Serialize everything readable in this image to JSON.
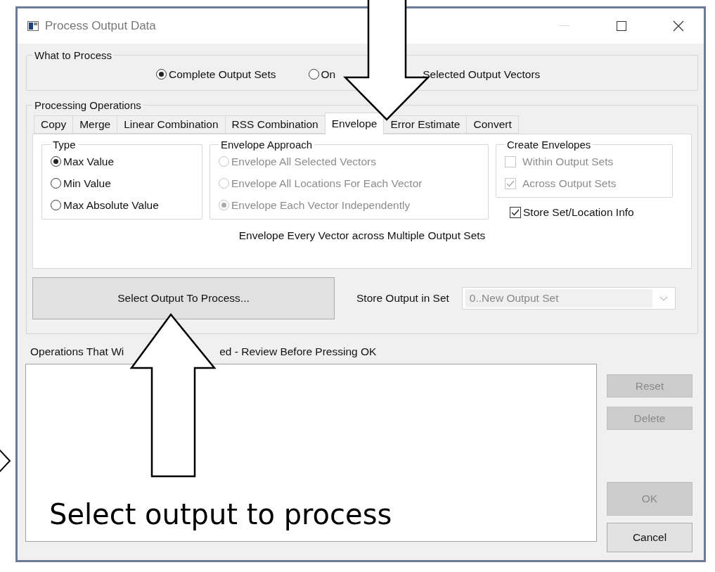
{
  "window": {
    "title": "Process Output Data",
    "minimize_disabled": true
  },
  "what_to_process": {
    "title": "What to Process",
    "options": [
      {
        "label_parts": [
          "Complete Output Sets"
        ],
        "selected": true
      },
      {
        "label_parts": [
          "On",
          "Selected Output Vectors"
        ],
        "selected": false
      }
    ]
  },
  "processing_operations": {
    "title": "Processing Operations",
    "tabs": [
      {
        "label": "Copy",
        "selected": false
      },
      {
        "label": "Merge",
        "selected": false
      },
      {
        "label": "Linear Combination",
        "selected": false
      },
      {
        "label": "RSS Combination",
        "selected": false
      },
      {
        "label": "Envelope",
        "selected": true
      },
      {
        "label": "Error Estimate",
        "selected": false
      },
      {
        "label": "Convert",
        "selected": false
      }
    ],
    "groups": [
      {
        "title": "Type",
        "kind": "radio",
        "items": [
          {
            "label": "Max Value",
            "selected": true,
            "disabled": false
          },
          {
            "label": "Min Value",
            "selected": false,
            "disabled": false
          },
          {
            "label": "Max Absolute Value",
            "selected": false,
            "disabled": false
          }
        ]
      },
      {
        "title": "Envelope Approach",
        "kind": "radio",
        "items": [
          {
            "label": "Envelope All Selected Vectors",
            "selected": false,
            "disabled": true
          },
          {
            "label": "Envelope All Locations For Each Vector",
            "selected": false,
            "disabled": true
          },
          {
            "label": "Envelope Each Vector Independently",
            "selected": true,
            "disabled": true
          }
        ]
      },
      {
        "title": "Create Envelopes",
        "kind": "checkbox",
        "items": [
          {
            "label": "Within Output Sets",
            "checked": false,
            "disabled": true
          },
          {
            "label": "Across Output Sets",
            "checked": true,
            "disabled": true
          }
        ]
      }
    ],
    "store_info": {
      "label": "Store Set/Location Info",
      "checked": true
    },
    "description": "Envelope Every Vector across Multiple Output Sets",
    "select_button": "Select Output To Process...",
    "store_output": {
      "label": "Store Output in Set",
      "value": "0..New Output Set",
      "disabled": true
    }
  },
  "operations": {
    "label_parts": [
      "Operations That Wi",
      "ed - Review Before Pressing OK"
    ]
  },
  "buttons": [
    {
      "label": "Reset",
      "disabled": true
    },
    {
      "label": "Delete",
      "disabled": true
    },
    {
      "label": "OK",
      "disabled": true
    },
    {
      "label": "Cancel",
      "disabled": false
    }
  ],
  "annotation": {
    "text": "Select output to process"
  }
}
